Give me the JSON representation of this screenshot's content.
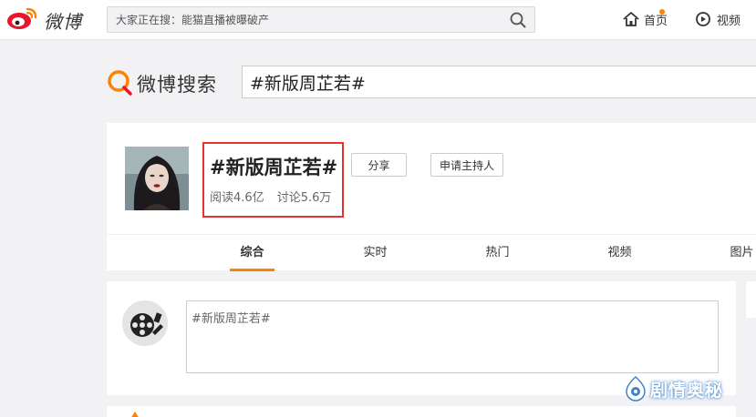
{
  "topbar": {
    "logo_text": "微博",
    "search_placeholder": "大家正在搜：能猫直播被曝破产",
    "nav": {
      "home": "首页",
      "video": "视频"
    }
  },
  "weibo_search": {
    "title": "微博搜索",
    "query": "#新版周芷若#"
  },
  "topic": {
    "title": "#新版周芷若#",
    "reads": "阅读4.6亿",
    "discussions": "讨论5.6万",
    "share_label": "分享",
    "host_label": "申请主持人",
    "highlight_color": "#e3342f"
  },
  "tabs": [
    {
      "label": "综合",
      "active": true
    },
    {
      "label": "实时",
      "active": false
    },
    {
      "label": "热门",
      "active": false
    },
    {
      "label": "视频",
      "active": false
    },
    {
      "label": "图片",
      "active": false
    }
  ],
  "composer": {
    "value": "#新版周芷若#"
  },
  "watermark": {
    "text": "剧情奥秘"
  },
  "colors": {
    "accent": "#ff8200",
    "page_bg": "#f2f2f5"
  }
}
